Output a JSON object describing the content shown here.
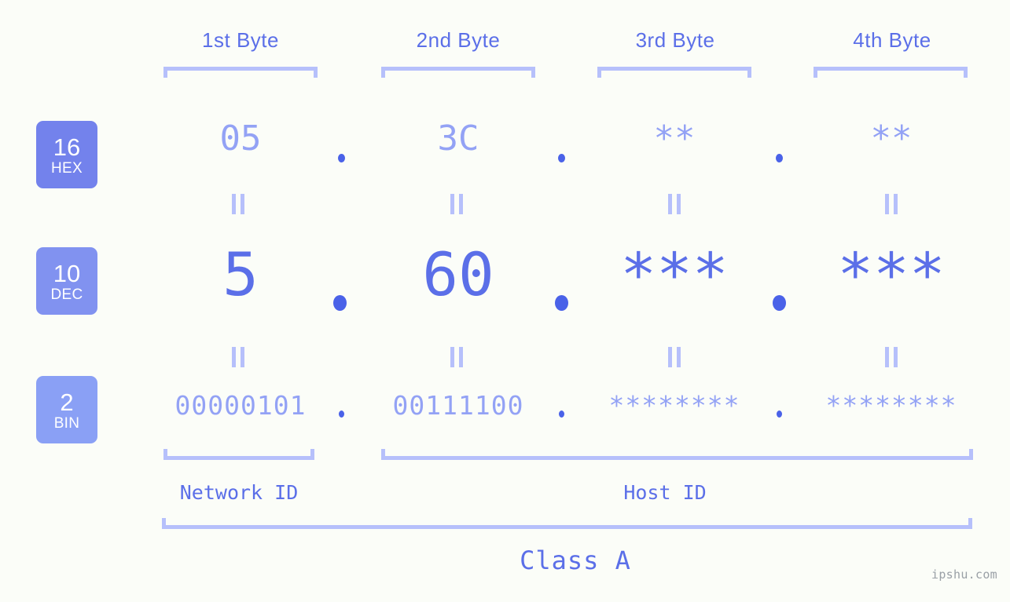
{
  "background_color": "#fbfdf8",
  "accent_color": "#5b6fe8",
  "accent_light_color": "#93a2f5",
  "bracket_color": "#b6c0fb",
  "byte_headers": [
    {
      "label": "1st Byte"
    },
    {
      "label": "2nd Byte"
    },
    {
      "label": "3rd Byte"
    },
    {
      "label": "4th Byte"
    }
  ],
  "rows": [
    {
      "badge_number": "16",
      "badge_name": "HEX",
      "badge_color": "#7382ec",
      "values": [
        "05",
        "3C",
        "**",
        "**"
      ],
      "separator": "."
    },
    {
      "badge_number": "10",
      "badge_name": "DEC",
      "badge_color": "#8192f0",
      "values": [
        "5",
        "60",
        "***",
        "***"
      ],
      "separator": "."
    },
    {
      "badge_number": "2",
      "badge_name": "BIN",
      "badge_color": "#8aa0f5",
      "values": [
        "00000101",
        "00111100",
        "********",
        "********"
      ],
      "separator": "."
    }
  ],
  "equality_marks": [
    "=",
    "=",
    "=",
    "=",
    "=",
    "=",
    "=",
    "="
  ],
  "id_sections": [
    {
      "label": "Network ID"
    },
    {
      "label": "Host ID"
    }
  ],
  "class_label": "Class A",
  "watermark": "ipshu.com"
}
